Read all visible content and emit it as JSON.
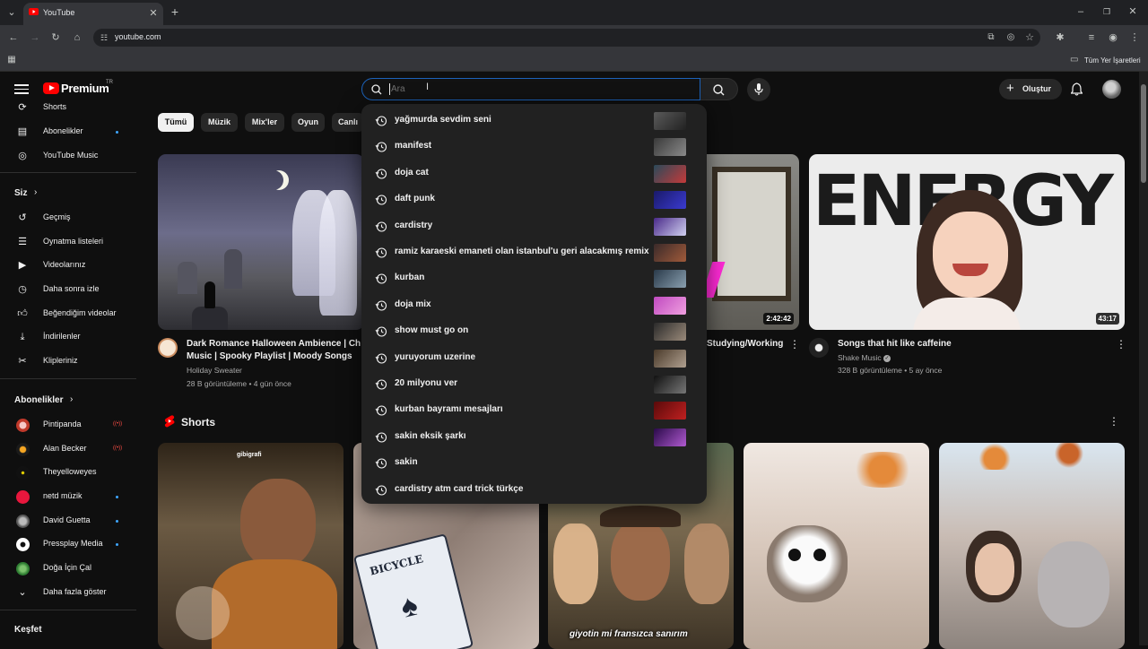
{
  "browser": {
    "tab_title": "YouTube",
    "url": "youtube.com",
    "bookmarks_label": "Tüm Yer İşaretleri"
  },
  "masthead": {
    "logo_text": "Premium",
    "logo_badge": "TR",
    "search_placeholder": "Ara",
    "create_label": "Oluştur"
  },
  "sidebar": {
    "top_items": [
      {
        "label": "Shorts",
        "icon": "shorts-icon"
      },
      {
        "label": "Abonelikler",
        "icon": "subscriptions-icon"
      },
      {
        "label": "YouTube Music",
        "icon": "music-icon"
      }
    ],
    "you_header": "Siz",
    "you_items": [
      {
        "label": "Geçmiş",
        "icon": "history-icon"
      },
      {
        "label": "Oynatma listeleri",
        "icon": "playlists-icon"
      },
      {
        "label": "Videolarınız",
        "icon": "your-videos-icon"
      },
      {
        "label": "Daha sonra izle",
        "icon": "watch-later-icon"
      },
      {
        "label": "Beğendiğim videolar",
        "icon": "liked-icon"
      },
      {
        "label": "İndirilenler",
        "icon": "downloads-icon"
      },
      {
        "label": "Klipleriniz",
        "icon": "clips-icon"
      }
    ],
    "subs_header": "Abonelikler",
    "subscriptions": [
      {
        "label": "Pintipanda",
        "badge": "live"
      },
      {
        "label": "Alan Becker",
        "badge": "live"
      },
      {
        "label": "Theyelloweyes",
        "badge": "none"
      },
      {
        "label": "netd müzik",
        "badge": "dot"
      },
      {
        "label": "David Guetta",
        "badge": "dot"
      },
      {
        "label": "Pressplay Media",
        "badge": "dot"
      },
      {
        "label": "Doğa İçin Çal",
        "badge": "none"
      }
    ],
    "show_more": "Daha fazla göster",
    "explore_header": "Keşfet"
  },
  "chips": [
    "Tümü",
    "Müzik",
    "Mix'ler",
    "Oyun",
    "Canlı"
  ],
  "videos": [
    {
      "title": "Dark Romance Halloween Ambience | Chill Music | Spooky Playlist | Moody Songs",
      "title_line1": "Dark Romance Halloween Ambience | Ch",
      "title_line2": "Music | Spooky Playlist | Moody Songs",
      "channel": "Holiday Sweater",
      "meta": "28 B görüntüleme • 4 gün önce"
    },
    {
      "title_visible": "Studying/Working",
      "duration": "2:42:42"
    },
    {
      "title": "Songs that hit like caffeine",
      "channel": "Shake Music",
      "meta": "328 B görüntüleme • 5 ay önce",
      "duration": "43:17",
      "thumb_text": "ENERGY"
    }
  ],
  "shorts": {
    "header": "Shorts",
    "items": [
      {
        "overlay": "gibigrafi"
      },
      {
        "overlay": "BICYCLE"
      },
      {
        "caption": "giyotin mi fransızca sanırım"
      },
      {
        "overlay": ""
      },
      {
        "overlay": ""
      }
    ]
  },
  "suggestions": [
    "yağmurda sevdim seni",
    "manifest",
    "doja cat",
    "daft punk",
    "cardistry",
    "ramiz karaeski emaneti olan istanbul'u geri alacakmış remix",
    "kurban",
    "doja mix",
    "show must go on",
    "yuruyorum uzerine",
    "20 milyonu ver",
    "kurban bayramı mesajları",
    "sakin eksik şarkı",
    "sakin",
    "cardistry atm card trick türkçe"
  ],
  "colors": {
    "brand": "#ff0000",
    "accent": "#3ea6ff",
    "background": "#0f0f0f"
  }
}
